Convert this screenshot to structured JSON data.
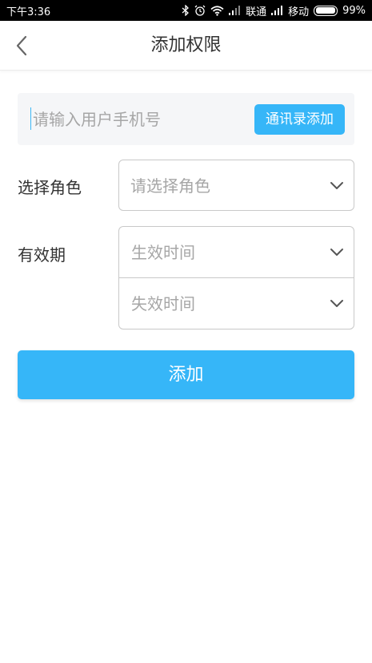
{
  "status_bar": {
    "time": "下午3:36",
    "carrier1": "联通",
    "carrier2": "移动",
    "battery_percent": "99%",
    "battery_level": 0.99,
    "icons": [
      "bluetooth-icon",
      "alarm-icon",
      "wifi-icon",
      "signal-icon",
      "battery-icon"
    ]
  },
  "navbar": {
    "title": "添加权限",
    "back_icon": "chevron-left-icon"
  },
  "form": {
    "phone_placeholder": "请输入用户手机号",
    "phone_value": "",
    "contacts_button": "通讯录添加",
    "role_label": "选择角色",
    "role_placeholder": "请选择角色",
    "validity_label": "有效期",
    "start_placeholder": "生效时间",
    "end_placeholder": "失效时间",
    "submit_label": "添加",
    "dropdown_icon": "chevron-down-icon"
  },
  "colors": {
    "accent": "#36b6f8",
    "text": "#333333",
    "placeholder": "#a6a6a6",
    "border": "#c9c9c9",
    "input_bg": "#f5f6f8"
  }
}
